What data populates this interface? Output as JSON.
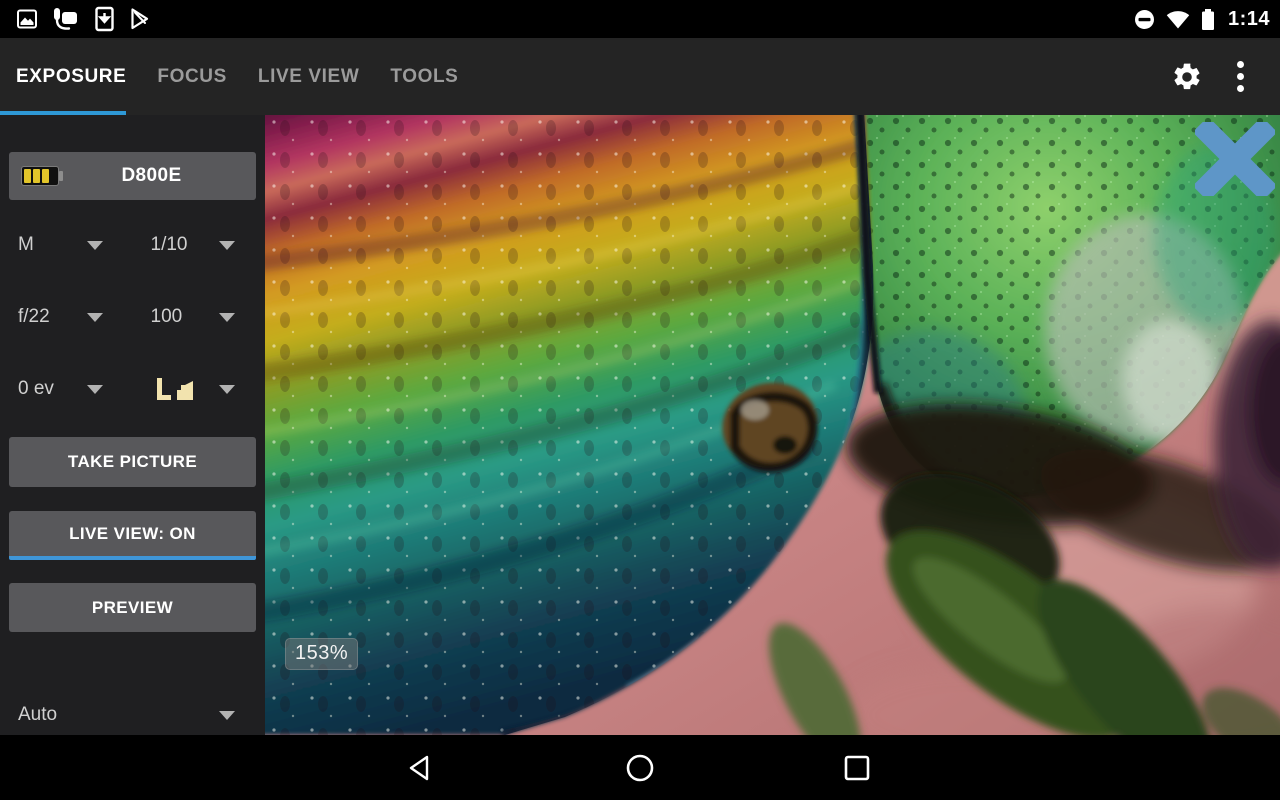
{
  "status_bar": {
    "time": "1:14",
    "left_icons": [
      "gallery-icon",
      "usb-otg-icon",
      "download-icon",
      "play-store-icon"
    ],
    "right_icons": [
      "do-not-disturb-icon",
      "wifi-icon",
      "battery-icon"
    ]
  },
  "app_bar": {
    "tabs": [
      {
        "label": "EXPOSURE",
        "active": true
      },
      {
        "label": "FOCUS",
        "active": false
      },
      {
        "label": "LIVE VIEW",
        "active": false
      },
      {
        "label": "TOOLS",
        "active": false
      }
    ],
    "actions": [
      "settings-gear-icon",
      "overflow-menu-icon"
    ]
  },
  "sidebar": {
    "camera": {
      "label": "D800E",
      "battery_icon": "camera-battery-level-icon"
    },
    "spinners": {
      "mode": "M",
      "shutter_speed": "1/10",
      "aperture": "f/22",
      "iso": "100",
      "exposure_compensation": "0 ev",
      "image_quality_icon": "jpeg-large-quality-icon"
    },
    "buttons": [
      {
        "label": "TAKE PICTURE"
      },
      {
        "label": "LIVE VIEW: ON",
        "active": true
      },
      {
        "label": "PREVIEW"
      }
    ],
    "bottom_spinner": "Auto"
  },
  "live_view": {
    "zoom_badge": "153%",
    "close_icon": "close-x-icon",
    "content_description": "Macro live view of an iridescent rainbow scarab beetle on a pink background"
  },
  "nav_bar": {
    "icons": [
      "back-icon",
      "home-icon",
      "recents-icon"
    ]
  },
  "colors": {
    "accent_blue": "#2e98d6",
    "live_view_underline_blue": "#3f96d8",
    "close_icon_blue": "#5e96c8",
    "quality_icon_cream": "#f2e3ae",
    "battery_bars_yellow": "#e2c52a"
  }
}
